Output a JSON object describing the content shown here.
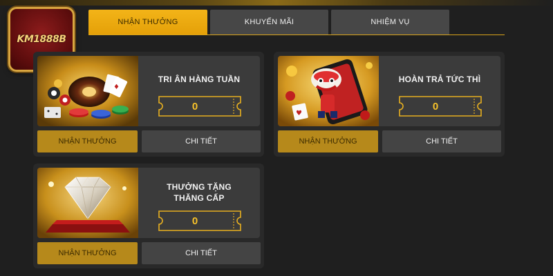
{
  "brand": {
    "logo_text": "KM1888B"
  },
  "tabs": [
    {
      "label": "NHẬN THƯỞNG",
      "active": true
    },
    {
      "label": "KHUYẾN MÃI",
      "active": false
    },
    {
      "label": "NHIỆM VỤ",
      "active": false
    }
  ],
  "promos": [
    {
      "title": "TRI ÂN HÀNG TUẦN",
      "value": "0",
      "claim_label": "NHẬN THƯỞNG",
      "detail_label": "CHI TIẾT"
    },
    {
      "title": "HOÀN TRẢ TỨC THÌ",
      "value": "0",
      "claim_label": "NHẬN THƯỞNG",
      "detail_label": "CHI TIẾT"
    },
    {
      "title_line1": "THƯỞNG TẶNG",
      "title_line2": "THĂNG CẤP",
      "value": "0",
      "claim_label": "NHẬN THƯỞNG",
      "detail_label": "CHI TIẾT"
    }
  ],
  "colors": {
    "accent_gold": "#f3b418",
    "claim_button": "#b6891b",
    "panel": "#3b3b3b",
    "background": "#1f1f1f"
  },
  "icons": [
    "casino-chips-roulette-image",
    "lion-dance-phone-image",
    "diamond-image",
    "ticket-icon"
  ]
}
